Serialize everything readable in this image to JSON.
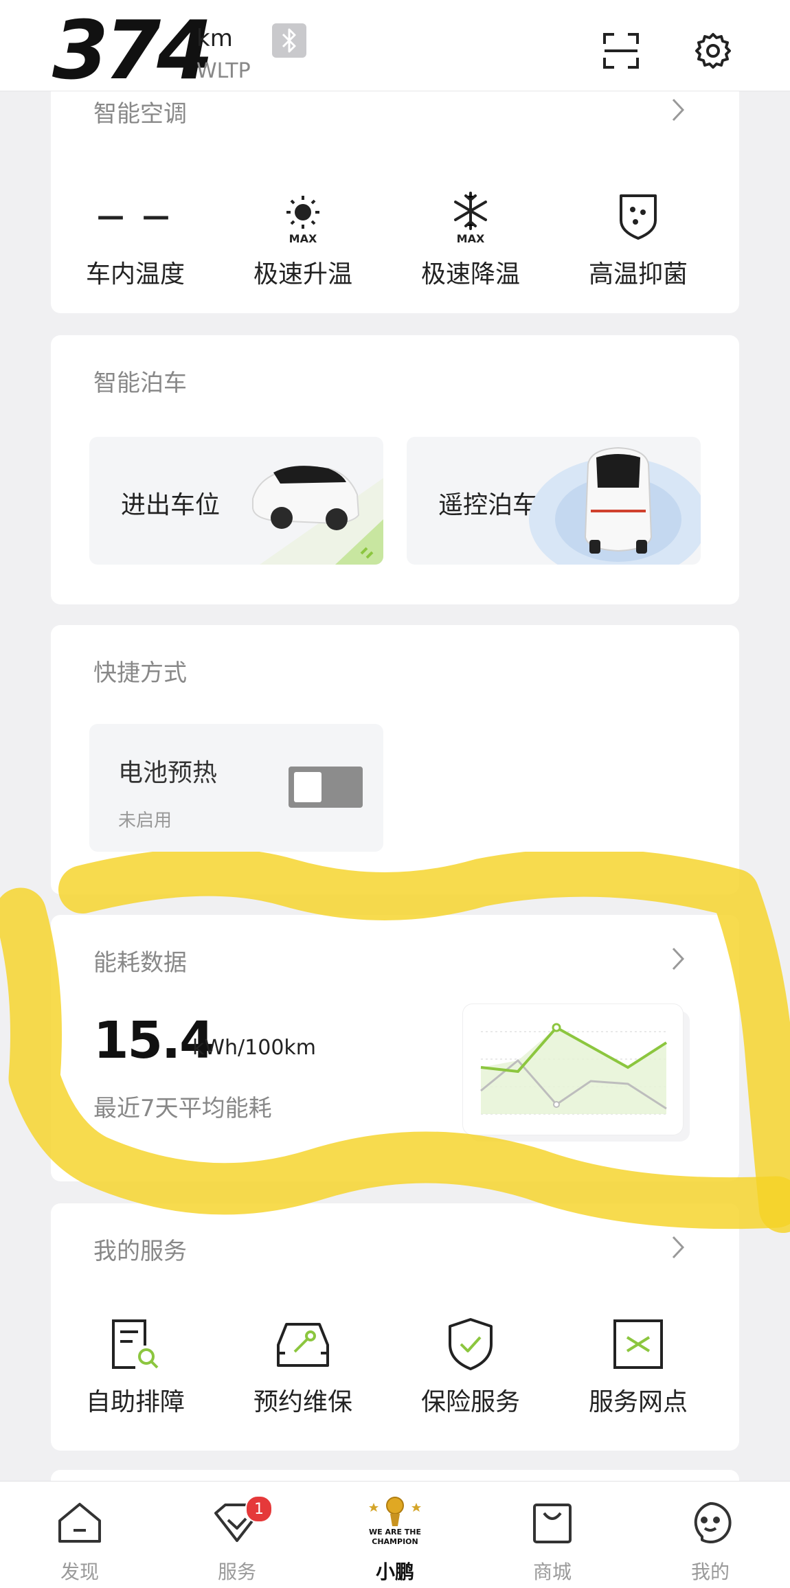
{
  "header": {
    "range_value": "374",
    "range_unit": "km",
    "range_standard": "WLTP",
    "icons": [
      "bluetooth-icon",
      "scan-icon",
      "gear-icon"
    ]
  },
  "climate": {
    "title": "智能空调",
    "items": [
      {
        "label": "车内温度",
        "value": "— —"
      },
      {
        "label": "极速升温",
        "icon_text": "MAX"
      },
      {
        "label": "极速降温",
        "icon_text": "MAX"
      },
      {
        "label": "高温抑菌"
      }
    ]
  },
  "parking": {
    "title": "智能泊车",
    "items": [
      {
        "label": "进出车位"
      },
      {
        "label": "遥控泊车"
      }
    ]
  },
  "shortcuts": {
    "title": "快捷方式",
    "battery_preheat": {
      "label": "电池预热",
      "status": "未启用",
      "enabled": false
    }
  },
  "energy": {
    "title": "能耗数据",
    "value": "15.4",
    "unit": "kWh/100km",
    "description": "最近7天平均能耗"
  },
  "services": {
    "title": "我的服务",
    "items": [
      {
        "label": "自助排障"
      },
      {
        "label": "预约维保"
      },
      {
        "label": "保险服务"
      },
      {
        "label": "服务网点"
      }
    ]
  },
  "bottom_nav": {
    "items": [
      {
        "label": "发现"
      },
      {
        "label": "服务",
        "badge": "1"
      },
      {
        "label": "小鹏",
        "active": true,
        "logo_text": "WE ARE THE CHAMPION"
      },
      {
        "label": "商城"
      },
      {
        "label": "我的"
      }
    ]
  },
  "colors": {
    "accent_green": "#8cc63f",
    "badge_red": "#e5393a",
    "highlight_yellow": "#f5d327"
  }
}
